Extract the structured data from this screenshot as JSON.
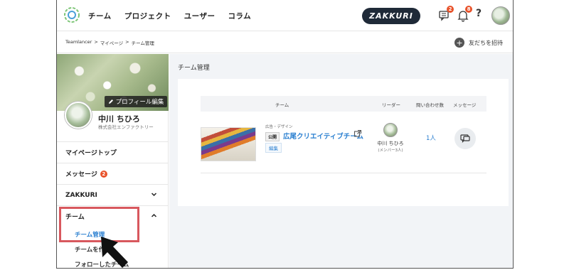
{
  "header": {
    "nav": [
      "チーム",
      "プロジェクト",
      "ユーザー",
      "コラム"
    ],
    "brand": "ZAKKURI",
    "messages_badge": "2",
    "notifications_badge": "8",
    "help": "?"
  },
  "breadcrumb": {
    "items": [
      "Teamlancer",
      ">",
      "マイページ",
      ">",
      "チーム管理"
    ],
    "invite_label": "友だちを招待"
  },
  "sidebar": {
    "edit_profile": "プロフィール編集",
    "user_name": "中川 ちひろ",
    "company": "株式会社エンファクトリー",
    "menu": {
      "mypage_top": "マイページトップ",
      "message": "メッセージ",
      "message_badge": "2",
      "zakkuri": "ZAKKURI",
      "team": "チーム",
      "team_manage": "チーム管理",
      "team_create": "チームを作",
      "followed": "フォローしたチーム"
    }
  },
  "main": {
    "title": "チーム管理",
    "table": {
      "col_team": "チーム",
      "col_leader": "リーダー",
      "col_inquiries": "問い合わせ数",
      "col_message": "メッセージ"
    },
    "team": {
      "category": "広告・デザイン",
      "visibility": "公開",
      "name": "広尾クリエイティブチーム",
      "edit": "編集",
      "leader_name": "中川 ちひろ",
      "leader_sub": "(メンバー3人)",
      "inquiries": "1人"
    }
  },
  "colors": {
    "accent_blue": "#2a7fd0",
    "badge_orange": "#e8522a",
    "brand_dark": "#1f2a38",
    "highlight_red": "#d8585e"
  }
}
